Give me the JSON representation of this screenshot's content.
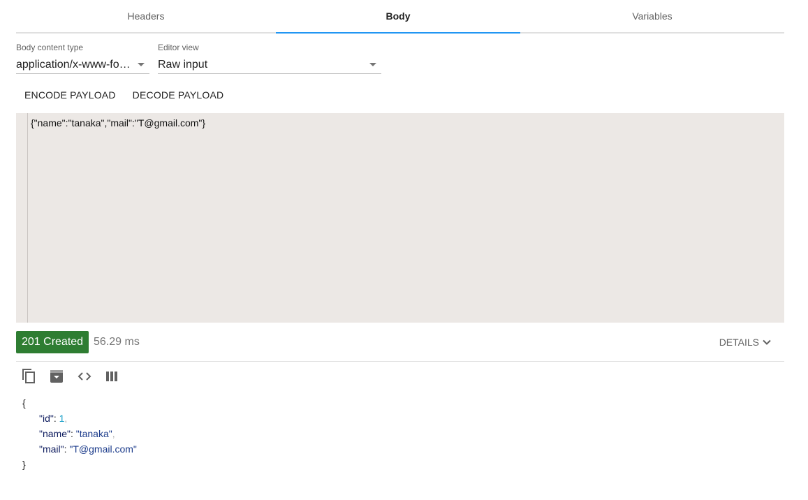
{
  "tabs": [
    {
      "label": "Headers"
    },
    {
      "label": "Body"
    },
    {
      "label": "Variables"
    }
  ],
  "body_content_type": {
    "label": "Body content type",
    "value": "application/x-www-fo…"
  },
  "editor_view": {
    "label": "Editor view",
    "value": "Raw input"
  },
  "actions": {
    "encode": "ENCODE PAYLOAD",
    "decode": "DECODE PAYLOAD"
  },
  "editor": {
    "content": "{\"name\":\"tanaka\",\"mail\":\"T@gmail.com\"}"
  },
  "response": {
    "status": "201 Created",
    "time": "56.29 ms",
    "details_label": "DETAILS",
    "status_color": "#2e7d32"
  },
  "toolbar_icons": [
    "copy-icon",
    "save-icon",
    "code-view-icon",
    "column-view-icon"
  ],
  "json_view": {
    "open": "{",
    "close": "}",
    "fields": [
      {
        "key": "\"id\"",
        "value": "1",
        "comma": ","
      },
      {
        "key": "\"name\"",
        "value": "\"tanaka\"",
        "comma": ","
      },
      {
        "key": "\"mail\"",
        "value": "\"T@gmail.com\"",
        "comma": ""
      }
    ]
  }
}
